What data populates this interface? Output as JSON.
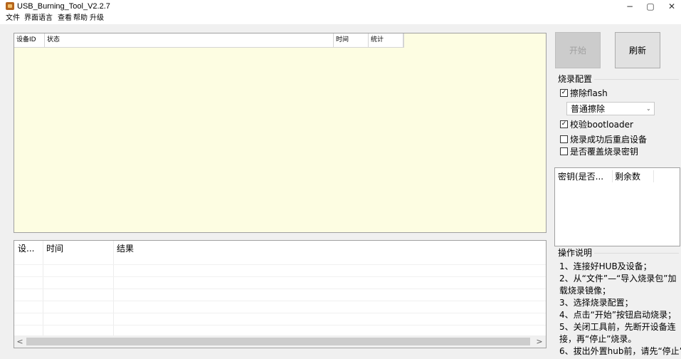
{
  "window": {
    "title": "USB_Burning_Tool_V2.2.7",
    "minimize": "−",
    "maximize": "▢",
    "close": "✕"
  },
  "menu": [
    "文件",
    "界面语言",
    "查看",
    "帮助",
    "升级"
  ],
  "device_table": {
    "columns": [
      "设备ID",
      "状态",
      "时间",
      "统计"
    ]
  },
  "log_table": {
    "columns": [
      "设...",
      "时间",
      "结果"
    ],
    "rows": []
  },
  "scrollbar": {
    "left": "<",
    "right": ">"
  },
  "buttons": {
    "start": "开始",
    "refresh": "刷新"
  },
  "burn_config": {
    "title": "烧录配置",
    "erase_flash": {
      "label": "擦除flash",
      "checked": true
    },
    "erase_mode": "普通擦除",
    "verify_bootloader": {
      "label": "校验bootloader",
      "checked": true
    },
    "reset_after_success": {
      "label": "烧录成功后重启设备",
      "checked": false
    },
    "overwrite_key": {
      "label": "是否覆盖烧录密钥",
      "checked": false
    }
  },
  "key_table": {
    "columns": [
      "密钥(是否...",
      "剩余数"
    ]
  },
  "instructions": {
    "title": "操作说明",
    "lines": [
      "1、连接好HUB及设备；",
      "2、从“文件”—“导入烧录包”加",
      "载烧录镜像；",
      "3、选择烧录配置；",
      "4、点击“开始”按钮启动烧录；",
      "5、关闭工具前，先断开设备连",
      "接，再“停止”烧录。",
      "6、拔出外置hub前，请先“停止”"
    ]
  },
  "colors": {
    "device_area_bg": "#fdfde2",
    "disabled_button_bg": "#cccccc"
  },
  "icons": {
    "app": "usb-burning-tool-app-icon",
    "checkbox_checked": "check-icon",
    "select": "chevron-down-icon"
  }
}
